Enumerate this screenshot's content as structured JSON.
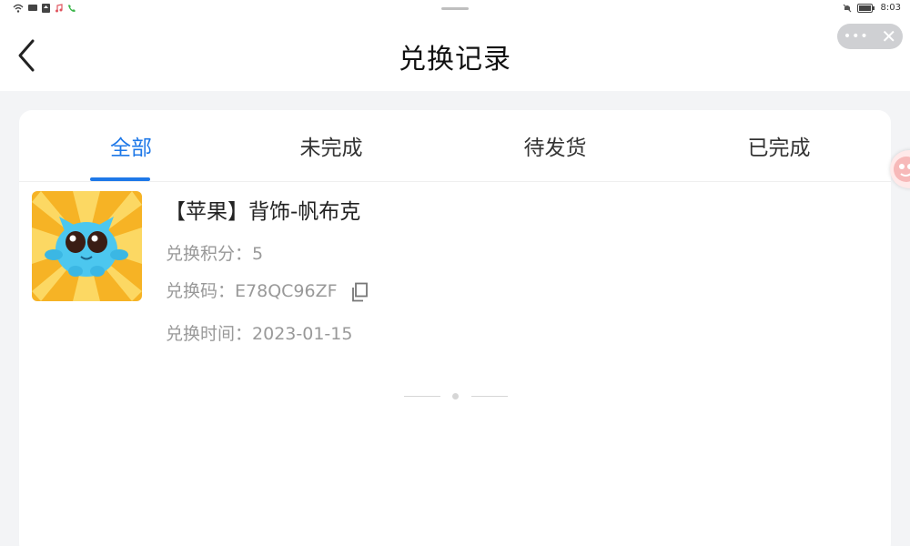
{
  "status_bar": {
    "time": "8:03"
  },
  "header": {
    "title": "兑换记录",
    "back_icon": "chevron-left-icon",
    "more_icon": "more-dots-icon",
    "close_icon": "close-icon"
  },
  "tabs": [
    {
      "label": "全部",
      "active": true
    },
    {
      "label": "未完成",
      "active": false
    },
    {
      "label": "待发货",
      "active": false
    },
    {
      "label": "已完成",
      "active": false
    }
  ],
  "order": {
    "title": "【苹果】背饰-帆布克",
    "points_label": "兑换积分：",
    "points_value": "5",
    "code_label": "兑换码：",
    "code_value": "E78QC96ZF",
    "date_label": "兑换时间：",
    "date_value": "2023-01-15"
  },
  "colors": {
    "accent": "#1e78e8",
    "background": "#f3f4f6",
    "muted_text": "#999999"
  }
}
